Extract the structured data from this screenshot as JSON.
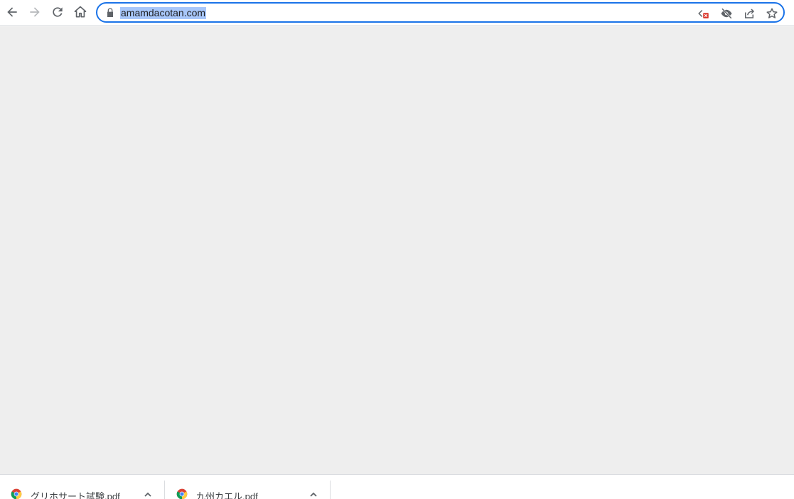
{
  "toolbar": {
    "back_icon": "back-arrow-icon",
    "forward_icon": "forward-arrow-icon",
    "reload_icon": "reload-icon",
    "home_icon": "home-icon"
  },
  "omnibox": {
    "url": "amamdacotan.com",
    "lock_icon": "lock-icon",
    "actions": [
      "blocked-popup-icon",
      "eye-off-icon",
      "share-icon",
      "star-icon"
    ],
    "accent_color": "#1a73e8",
    "selection_color": "#a8c7fa"
  },
  "content": {
    "background": "#eeeeee"
  },
  "downloads": [
    {
      "filename": "グリホサート試験.pdf",
      "icon": "chrome-icon"
    },
    {
      "filename": "九州カエル.pdf",
      "icon": "chrome-icon"
    }
  ]
}
